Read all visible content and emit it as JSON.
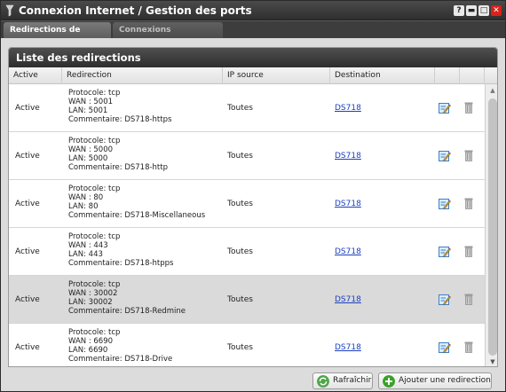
{
  "window": {
    "title": "Connexion Internet / Gestion des ports",
    "help_label": "?",
    "minimize_label": "▬",
    "maximize_label": "□",
    "close_label": "✕"
  },
  "tabs": [
    {
      "label": "Redirections de ports",
      "active": true
    },
    {
      "label": "Connexions entrantes",
      "active": false
    }
  ],
  "list": {
    "title": "Liste des redirections",
    "columns": [
      "Active",
      "Redirection",
      "IP source",
      "Destination"
    ],
    "rows": [
      {
        "active": "Active",
        "protocol": "Protocole: tcp",
        "wan": "WAN : 5001",
        "lan": "LAN: 5001",
        "comment": "Commentaire: DS718-https",
        "ip": "Toutes",
        "dest": "DS718"
      },
      {
        "active": "Active",
        "protocol": "Protocole: tcp",
        "wan": "WAN : 5000",
        "lan": "LAN: 5000",
        "comment": "Commentaire: DS718-http",
        "ip": "Toutes",
        "dest": "DS718"
      },
      {
        "active": "Active",
        "protocol": "Protocole: tcp",
        "wan": "WAN : 80",
        "lan": "LAN: 80",
        "comment": "Commentaire: DS718-Miscellaneous",
        "ip": "Toutes",
        "dest": "DS718"
      },
      {
        "active": "Active",
        "protocol": "Protocole: tcp",
        "wan": "WAN : 443",
        "lan": "LAN: 443",
        "comment": "Commentaire: DS718-htpps",
        "ip": "Toutes",
        "dest": "DS718"
      },
      {
        "active": "Active",
        "protocol": "Protocole: tcp",
        "wan": "WAN : 30002",
        "lan": "LAN: 30002",
        "comment": "Commentaire: DS718-Redmine",
        "ip": "Toutes",
        "dest": "DS718"
      },
      {
        "active": "Active",
        "protocol": "Protocole: tcp",
        "wan": "WAN : 6690",
        "lan": "LAN: 6690",
        "comment": "Commentaire: DS718-Drive",
        "ip": "Toutes",
        "dest": "DS718"
      }
    ],
    "selected_row_index": 4
  },
  "footer": {
    "refresh_label": "Rafraîchir",
    "add_label": "Ajouter une redirection"
  },
  "icons": {
    "title": "funnel-icon",
    "edit": "edit-icon",
    "delete": "trash-icon",
    "refresh": "refresh-icon",
    "add": "add-icon"
  },
  "colors": {
    "titlebar": "#2f2f2f",
    "link": "#1a3fbf",
    "close": "#d8221a",
    "add_green": "#3aa12a",
    "selected_row": "#dadada"
  }
}
